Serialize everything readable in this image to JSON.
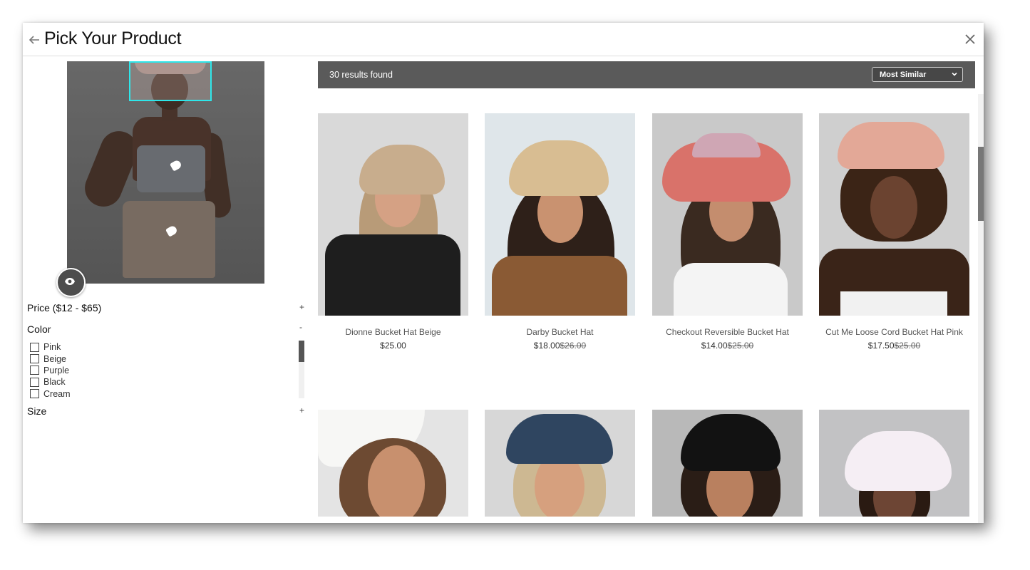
{
  "header": {
    "title": "Pick Your Product"
  },
  "filters": {
    "price": {
      "label": "Price ($12 - $65)",
      "toggle": "+"
    },
    "color": {
      "label": "Color",
      "toggle": "-",
      "options": [
        "Pink",
        "Beige",
        "Purple",
        "Black",
        "Cream"
      ]
    },
    "size": {
      "label": "Size",
      "toggle": "+"
    }
  },
  "results": {
    "count_text": "30 results found",
    "sort": {
      "selected": "Most Similar"
    }
  },
  "products": [
    {
      "name": "Dionne Bucket Hat Beige",
      "price": "$25.00",
      "orig": ""
    },
    {
      "name": "Darby Bucket Hat",
      "price": "$18.00",
      "orig": "$26.00"
    },
    {
      "name": "Checkout Reversible Bucket Hat",
      "price": "$14.00",
      "orig": "$25.00"
    },
    {
      "name": "Cut Me Loose Cord Bucket Hat Pink",
      "price": "$17.50",
      "orig": "$25.00"
    }
  ],
  "colors": {
    "overlay": "#2ee6ea",
    "bar": "#5a5a5a",
    "dark_button": "#4d4d4d"
  },
  "icons": {
    "back": "arrow-left-icon",
    "close": "close-icon",
    "eye": "eye-icon",
    "sort": "chevron-down-icon",
    "tag": "price-tag-icon"
  }
}
